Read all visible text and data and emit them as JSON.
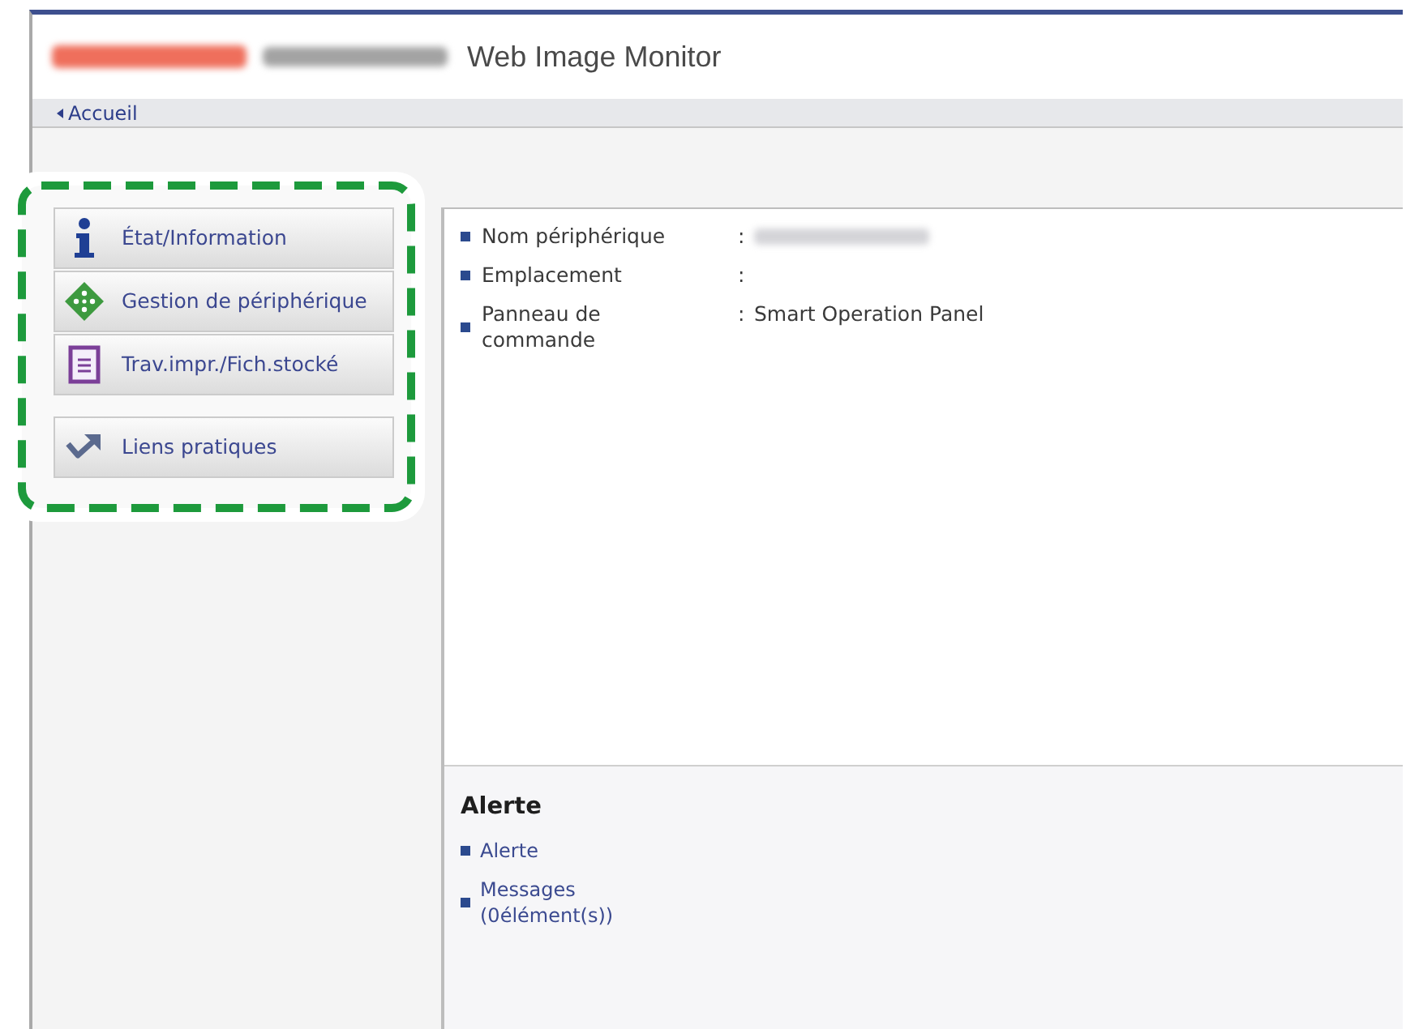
{
  "header": {
    "logo_redacted": true,
    "title": "Web Image Monitor"
  },
  "breadcrumb": {
    "label": "Accueil"
  },
  "sidebar": {
    "highlighted": true,
    "groups": [
      {
        "items": [
          {
            "kind": "info",
            "label": "État/Information"
          },
          {
            "kind": "device",
            "label": "Gestion de périphérique"
          },
          {
            "kind": "document",
            "label": "Trav.impr./Fich.stocké"
          }
        ]
      },
      {
        "items": [
          {
            "kind": "link",
            "label": "Liens pratiques"
          }
        ]
      }
    ]
  },
  "device_info": [
    {
      "label": "Nom périphérique",
      "separator": ":",
      "redacted": true
    },
    {
      "label": "Emplacement",
      "separator": ":",
      "redacted": false
    },
    {
      "label": "Panneau de commande",
      "separator": ":",
      "value": "Smart Operation Panel",
      "redacted": false
    }
  ],
  "alert": {
    "title": "Alerte",
    "links": [
      {
        "label": "Alerte"
      },
      {
        "label": "Messages (0élément(s))"
      }
    ]
  }
}
